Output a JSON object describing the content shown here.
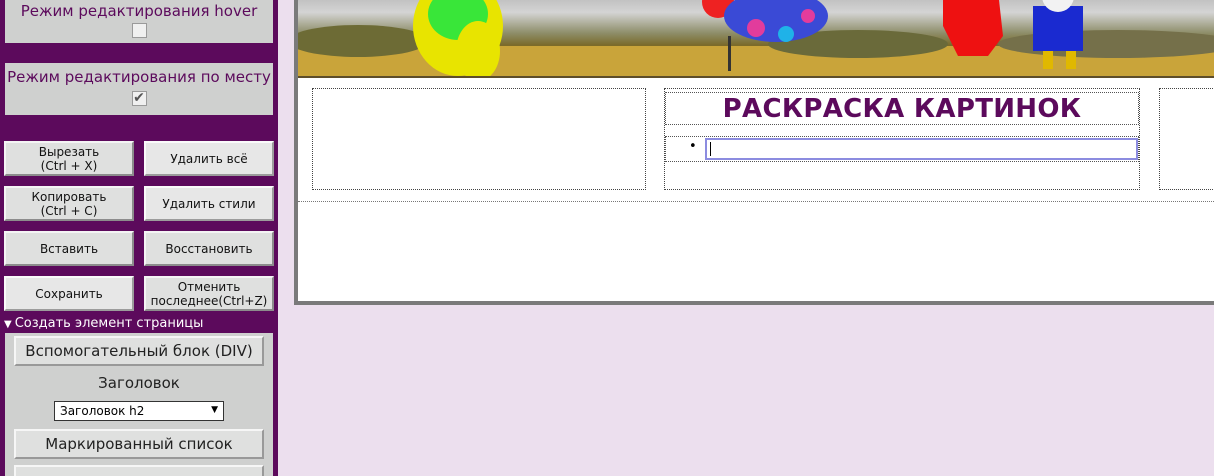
{
  "panel": {
    "hover_mode": {
      "label": "Режим редактирования hover",
      "checked": false
    },
    "inplace_mode": {
      "label": "Режим редактирования по месту",
      "checked": true,
      "check_glyph": "✔"
    },
    "buttons": {
      "cut": "Вырезать\n(Ctrl + X)",
      "delete_all": "Удалить всё",
      "copy": "Копировать\n(Ctrl + C)",
      "delete_styles": "Удалить стили",
      "paste": "Вставить",
      "restore": "Восстановить",
      "save": "Сохранить",
      "undo": "Отменить\nпоследнее(Ctrl+Z)"
    },
    "create_section": {
      "toggle_label": "Создать элемент страницы",
      "div_button": "Вспомогательный блок (DIV)",
      "heading_label": "Заголовок",
      "heading_select_value": "Заголовок h2",
      "bullet_list_button": "Маркированный список"
    }
  },
  "editor": {
    "title": "РАСКРАСКА КАРТИНОК",
    "list_bullet": "•",
    "list_item_value": ""
  },
  "colors": {
    "accent": "#5c0a5c",
    "page_bg": "#ecdfee",
    "panel_box": "#cfd0cf",
    "focus_border": "#8c8ce0"
  }
}
